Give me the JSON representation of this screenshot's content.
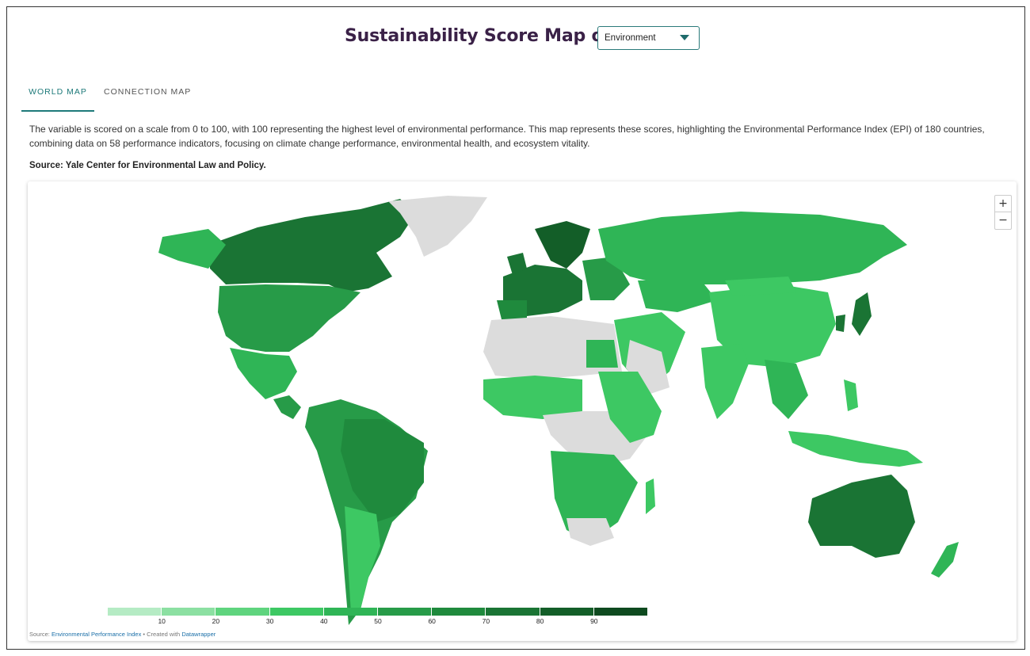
{
  "header": {
    "title": "Sustainability Score Map of",
    "select_value": "Environment"
  },
  "tabs": [
    {
      "label": "WORLD MAP",
      "active": true
    },
    {
      "label": "CONNECTION MAP",
      "active": false
    }
  ],
  "description": "The variable is scored on a scale from 0 to 100, with 100 representing the highest level of environmental performance. This map represents these scores, highlighting the Environmental Performance Index (EPI) of 180 countries, combining data on 58 performance indicators, focusing on climate change performance, environmental health, and ecosystem vitality.",
  "source": "Source: Yale Center for Environmental Law and Policy.",
  "map": {
    "zoom_in": "+",
    "zoom_out": "−",
    "no_data_color": "#dcdcdc",
    "legend": {
      "ticks": [
        "10",
        "20",
        "30",
        "40",
        "50",
        "60",
        "70",
        "80",
        "90"
      ],
      "colors": [
        "#b5ebc4",
        "#8ce0a2",
        "#5fd47e",
        "#3dc863",
        "#2fb556",
        "#279b48",
        "#1f8a3d",
        "#1a7434",
        "#135e28",
        "#0e4a1f"
      ]
    },
    "credits": {
      "prefix": "Source: ",
      "source_link": "Environmental Performance Index",
      "middle": " • Created with ",
      "tool_link": "Datawrapper"
    }
  }
}
